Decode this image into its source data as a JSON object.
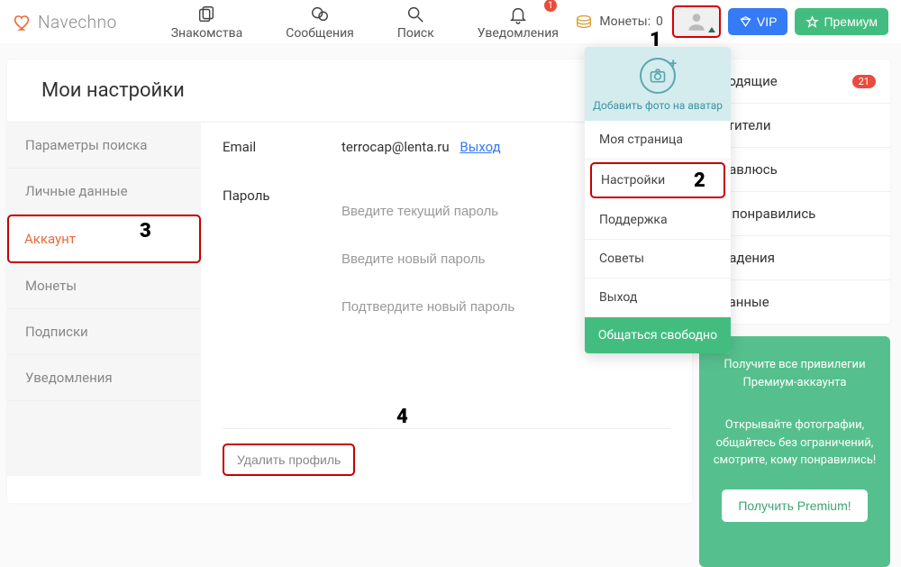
{
  "brand": "Navechno",
  "nav": {
    "dating": "Знакомства",
    "messages": "Сообщения",
    "search": "Поиск",
    "notifications": "Уведомления",
    "notif_badge": "1"
  },
  "header": {
    "coins_label": "Монеты:",
    "coins_value": "0",
    "vip": "VIP",
    "premium": "Премиум"
  },
  "page_title": "Мои настройки",
  "side_tabs": {
    "search_params": "Параметры поиска",
    "personal": "Личные данные",
    "account": "Аккаунт",
    "coins": "Монеты",
    "subs": "Подписки",
    "notifs": "Уведомления"
  },
  "account": {
    "email_label": "Email",
    "email_value": "terrocap@lenta.ru",
    "logout": "Выход",
    "password_label": "Пароль",
    "pw_current": "Введите текущий пароль",
    "pw_new": "Введите новый пароль",
    "pw_confirm": "Подтвердите новый пароль",
    "delete": "Удалить профиль"
  },
  "dropdown": {
    "add_photo": "Добавить фото на аватар",
    "my_page": "Моя страница",
    "settings": "Настройки",
    "support": "Поддержка",
    "tips": "Советы",
    "logout": "Выход",
    "chat_free": "Общаться свободно"
  },
  "right": {
    "incoming": "дходящие",
    "incoming_count": "21",
    "visitors": "сетители",
    "i_like": "нравлюсь",
    "liked_me": "не понравились",
    "matches": "впадения",
    "favorites": "бранные"
  },
  "promo": {
    "line1": "Получите все привилегии Премиум-аккаунта",
    "line2": "Открывайте фотографии, общайтесь без ограничений, смотрите, кому понравились!",
    "btn": "Получить Premium!"
  },
  "annotations": {
    "a1": "1",
    "a2": "2",
    "a3": "3",
    "a4": "4"
  }
}
